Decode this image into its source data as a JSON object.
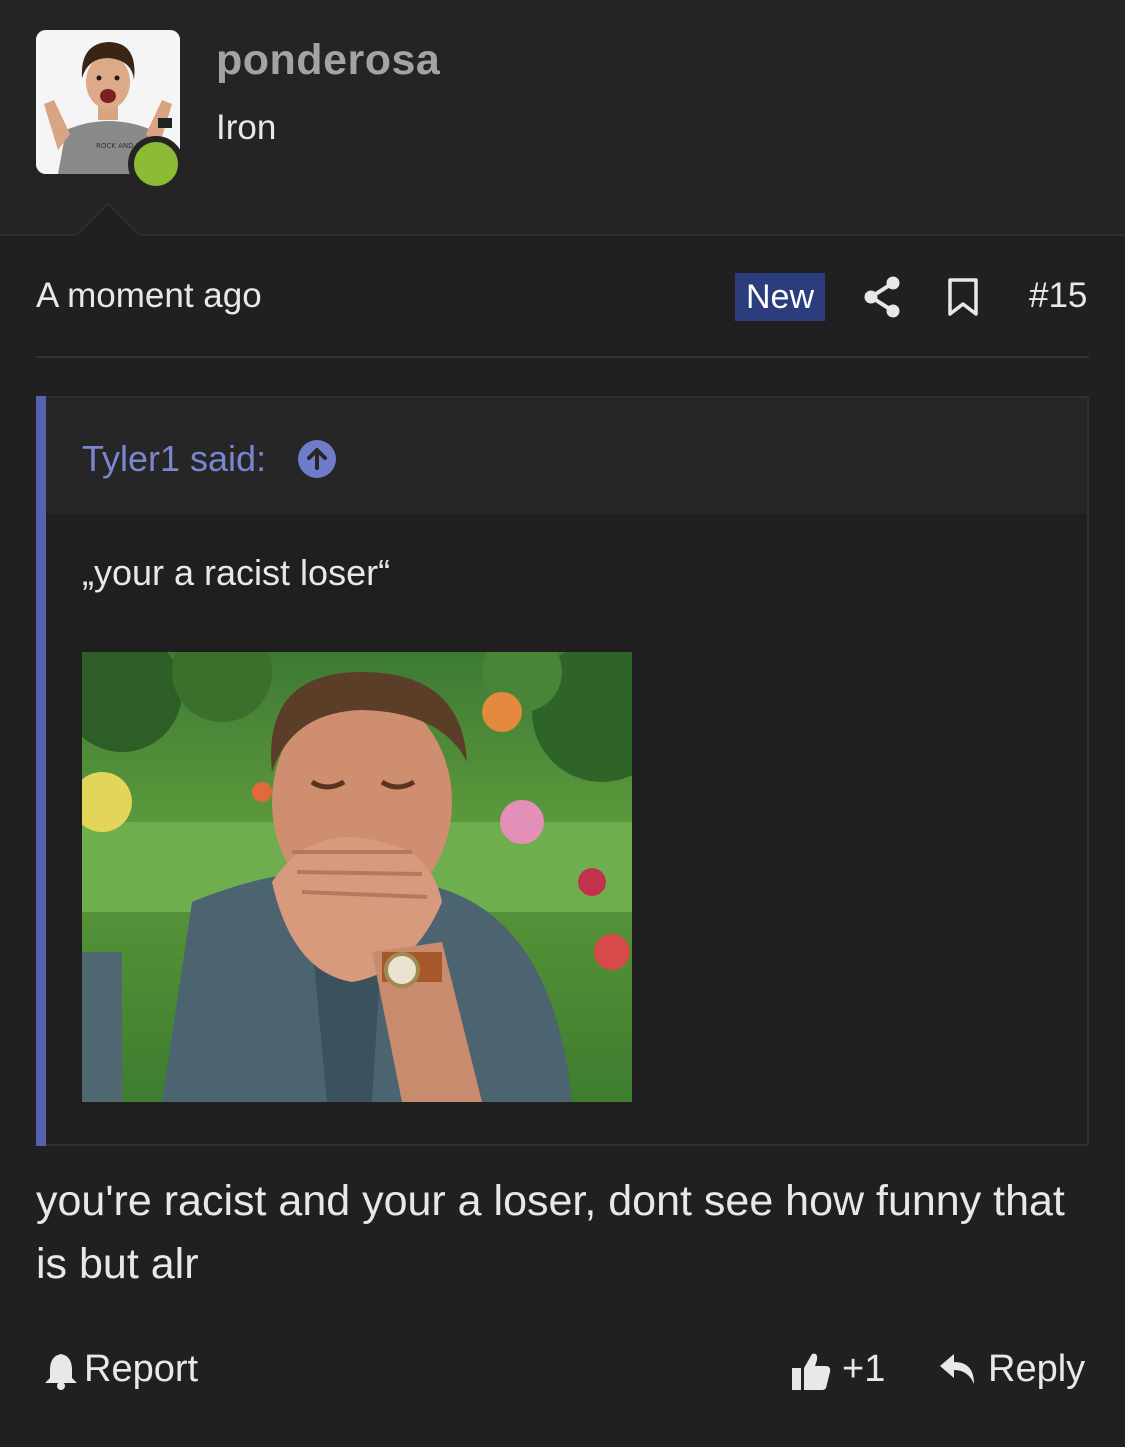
{
  "user": {
    "name": "ponderosa",
    "rank": "Iron",
    "online": true
  },
  "post": {
    "timestamp": "A moment ago",
    "badge": "New",
    "number": "#15",
    "quote": {
      "author_line": "Tyler1 said:",
      "text": "„your a racist loser“"
    },
    "body": "you're racist and your a loser, dont see how funny that is but alr"
  },
  "actions": {
    "report_label": "Report",
    "like_label": "+1",
    "reply_label": "Reply"
  },
  "icons": {
    "share": "share-icon",
    "bookmark": "bookmark-icon",
    "quote_jump": "arrow-up-circle-icon",
    "report": "bell-icon",
    "like": "thumbs-up-icon",
    "reply": "reply-arrow-icon"
  },
  "colors": {
    "background": "#202020",
    "header_background": "#242424",
    "online_dot": "#8cbb36",
    "new_badge": "#2b3d7c",
    "quote_accent": "#5562ad",
    "quote_author": "#7a86cf"
  }
}
